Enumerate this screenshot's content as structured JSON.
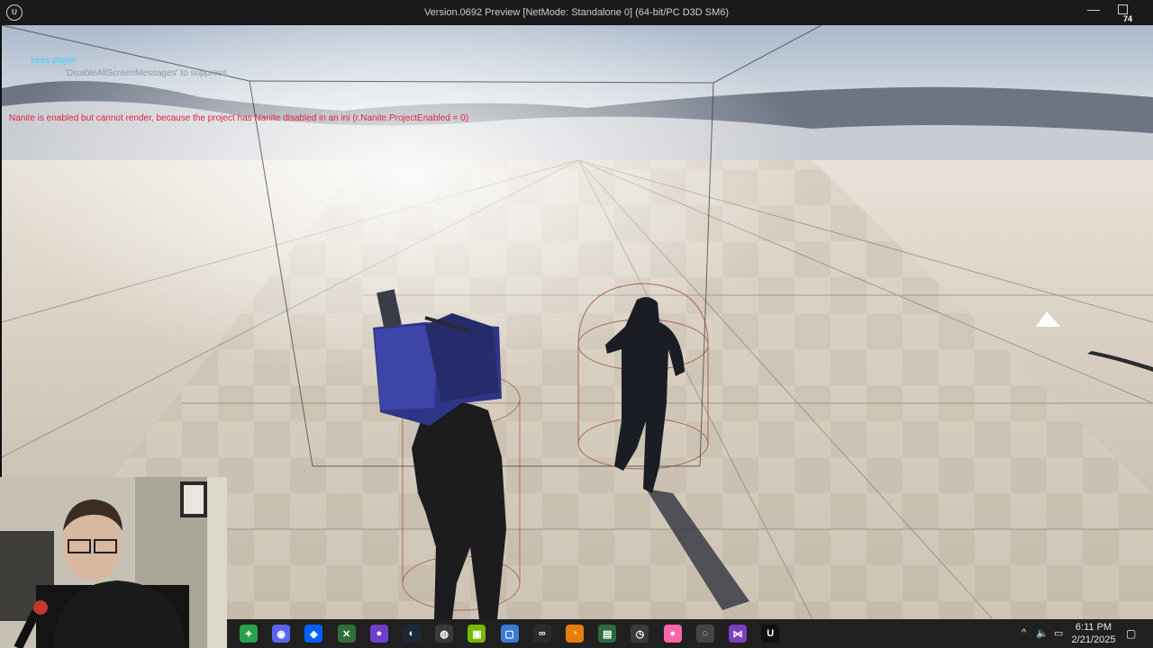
{
  "window": {
    "title": "Version.0692 Preview [NetMode: Standalone 0]  (64-bit/PC D3D SM6)",
    "fps": "74",
    "minimize_glyph": "—"
  },
  "screen_messages": {
    "debug": "sees player",
    "suppress_hint": "'DisableAllScreenMessages' to suppress",
    "warning": "Nanite is enabled but cannot render, because the project has Nanite disabled in an ini (r.Nanite.ProjectEnabled = 0)"
  },
  "colors": {
    "debug_text": "#3ad0ff",
    "warning_text": "#e2233b",
    "taskbar": "#202020"
  },
  "taskbar": {
    "apps": [
      {
        "name": "spotify-like-icon",
        "glyph": "✦",
        "color": "#2aa14a"
      },
      {
        "name": "discord-icon",
        "glyph": "◉",
        "color": "#5865f2"
      },
      {
        "name": "dropbox-icon",
        "glyph": "◆",
        "color": "#0061fe"
      },
      {
        "name": "xbox-icon",
        "glyph": "✕",
        "color": "#2f6f3a"
      },
      {
        "name": "github-icon",
        "glyph": "●",
        "color": "#6e40c9"
      },
      {
        "name": "steam-icon",
        "glyph": "◐",
        "color": "#1b2838"
      },
      {
        "name": "obs-icon",
        "glyph": "◍",
        "color": "#3a3a3a"
      },
      {
        "name": "nvidia-icon",
        "glyph": "▣",
        "color": "#76b900"
      },
      {
        "name": "explorer-icon",
        "glyph": "▢",
        "color": "#3a7bd5"
      },
      {
        "name": "meta-icon",
        "glyph": "∞",
        "color": "#2b2b2b"
      },
      {
        "name": "blender-icon",
        "glyph": "◔",
        "color": "#e87d0d"
      },
      {
        "name": "terminal-icon",
        "glyph": "▤",
        "color": "#2d6b3d"
      },
      {
        "name": "clock-icon",
        "glyph": "◷",
        "color": "#3a3a3a"
      },
      {
        "name": "osu-icon",
        "glyph": "●",
        "color": "#ff66aa"
      },
      {
        "name": "recorder-icon",
        "glyph": "◌",
        "color": "#444444"
      },
      {
        "name": "visual-studio-icon",
        "glyph": "⋈",
        "color": "#7b3fbf"
      },
      {
        "name": "unreal-icon",
        "glyph": "U",
        "color": "#111111"
      }
    ],
    "time": "6:11 PM",
    "date": "2/21/2025",
    "tray_chevron": "^"
  }
}
